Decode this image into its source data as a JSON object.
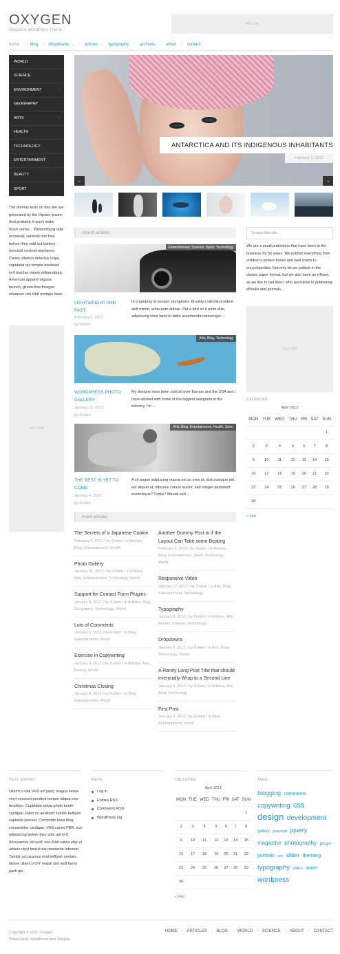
{
  "site": {
    "title": "OXYGEN",
    "tagline": "Magazine WordPress Theme",
    "ad_top": "468 x 60"
  },
  "nav": {
    "items": [
      "home",
      "blog",
      "dropdowns",
      "articles",
      "typography",
      "archives",
      "about",
      "contact"
    ]
  },
  "categories": [
    "WORLD",
    "SCIENCE",
    "ENVIRONMENT",
    "GEOGRAPHY",
    "ARTS",
    "HEALTH",
    "TECHNOLOGY",
    "ENTERTAINMENT",
    "BEAUTY",
    "SPORT"
  ],
  "sidebar_left": {
    "text": "The dummy texts on this site are generated by the Hipster Ipsum. And probably it won't make much sense... Williamsburg odio occaecat, sartorial non fixie before they sold out bankey nesciunt nostrud wayfarers. Caries ullamco delectus culpa, cupidatat qui tempor biodiesel lo-fi butcher minim williamsburg. American apparel organic brunch, gluten-free freegan whatever nisi nihil mixtape twee.",
    "ad": "160 x 600"
  },
  "slider": {
    "caption": "ANTARCTICA AND ITS INDIGENOUS INHABITANTS",
    "date": "February 5, 2012",
    "prev": "←",
    "next": "→"
  },
  "sidebar_right": {
    "search_placeholder": "Search this site...",
    "about": "We are a small publishers that have been in the business for 50 years. We publish everything from children's picture books and wall charts to encyclopedias. Not only do we publish in the classic paper format, but we also have an eTeam, as we like to call them, who specialise in publishing eBooks and journals.",
    "ad": "250 x 250"
  },
  "recent": {
    "heading": "recent articles",
    "posts": [
      {
        "tags": "Entertainment, Science, Sport, Technology",
        "title": "LIGHTWEIGHT AND FAST",
        "date": "February 5, 2012",
        "author": "by Griden",
        "excerpt": "In chambray id veniam stumptown. Brooklyn mlkshk proident wolf minim, echo park artisan. Put a bird on it anim duis, adipisicing twee farm-to-table assumenda messenger…"
      },
      {
        "tags": "Arts, Blog, Technology",
        "title": "WORDPRESS PHOTO GALLERY",
        "date": "January 21, 2012",
        "author": "by Griden",
        "excerpt": "My designs have been sold all over Europe and the USA and I have worked with some of the biggest designers in the industry. I'm…"
      },
      {
        "tags": "Arts, Blog, Entertainment, Health, Sport",
        "title": "THE BEST IS YET TO COME",
        "date": "January 4, 2012",
        "author": "by Griden",
        "excerpt": "A sit augue adipiscing massa est ac eros et, duis natoque pid est aliquet et, ridiculus cursus auctor, sed integer parturient scelerisque? Turpis? Mauris sed…"
      }
    ]
  },
  "more": {
    "heading": "more articles",
    "left": [
      {
        "title": "The Secrets of a Japanese Cookie",
        "meta": "February 5, 2012 / by Griden / in Articles, Blog, Entertainment, Health"
      },
      {
        "title": "Photo Gallery",
        "meta": "January 21, 2012 / by Griden / in Articles, Arts, Entertainment, Technology, World"
      },
      {
        "title": "Support for Contact Form Plugins",
        "meta": "January 8, 2012 / by Griden / in Articles, Blog, Geography, Technology, World"
      },
      {
        "title": "Lots of Comments",
        "meta": "January 6, 2012 / by Griden / in Blog, Entertainment, World"
      },
      {
        "title": "Exercise in Copywriting",
        "meta": "January 4, 2012 / by Griden / in Articles, Arts, Beauty, World"
      },
      {
        "title": "Christmas Closing",
        "meta": "January 4, 2012 / by Griden / in Blog, Entertainment, World"
      }
    ],
    "right": [
      {
        "title": "Another Dummy Post to if the Layout Can Take some Beating",
        "meta": "February 5, 2012 / by Griden / in Articles, Blog, Entertainment, Sport, Technology, World"
      },
      {
        "title": "Responsive Video",
        "meta": "January 17, 2012 / by Griden / in Arts, Blog, Entertainment, Technology"
      },
      {
        "title": "Typography",
        "meta": "January 8, 2012 / by Griden / in Articles, Arts, Beauty, Science, Technology"
      },
      {
        "title": "Dropdowns",
        "meta": "January 8, 2012 / by Griden / in Arts, Blog, Technology, World"
      },
      {
        "title": "A Rarely Long Post Title that should eventually Wrap to a Second Line",
        "meta": "January 4, 2012 / by Griden / in Articles, Arts, Blog, Technology"
      },
      {
        "title": "First Post",
        "meta": "January 4, 2012 / by Griden / in Blog, Entertainment, World"
      }
    ]
  },
  "calendar": {
    "label": "CALENDAR",
    "month": "April 2012",
    "days": [
      "MON",
      "TUE",
      "WED",
      "THU",
      "FRI",
      "SAT",
      "SUN"
    ],
    "weeks": [
      [
        "",
        "",
        "",
        "",
        "",
        "",
        "1"
      ],
      [
        "2",
        "3",
        "4",
        "5",
        "6",
        "7",
        "8"
      ],
      [
        "9",
        "10",
        "11",
        "12",
        "13",
        "14",
        "15"
      ],
      [
        "16",
        "17",
        "18",
        "19",
        "20",
        "21",
        "22"
      ],
      [
        "23",
        "24",
        "25",
        "26",
        "27",
        "28",
        "29"
      ],
      [
        "30",
        "",
        "",
        "",
        "",
        "",
        ""
      ]
    ],
    "prev": "« Feb"
  },
  "footer": {
    "text_widget": {
      "title": "TEXT WIDGET",
      "text": "Ullamco nihil VHS art party, magna seitan vinyl nesciunt proident tempor aliqua vice brooklyn. Cupidatat salvia photo booth cardigan, banh mi aesthetic tumblr keffiyeh sapiente placeat. Commodo twee blog consectetur cardigan. VHS caries PBR, non adipisicing before they sold out lo-fi. Accusamus elit wolf, non 8-bit salvia etsy ut artisan vinyl beard nisi mustache laborum. Tumblr accusamus viral keffiyeh veniam, labore ullamco DIY vegan sint wolf fanny pack qui."
    },
    "meta": {
      "title": "META",
      "items": [
        "Log in",
        "Entries RSS",
        "Comments RSS",
        "WordPress.org"
      ]
    },
    "calendar_title": "CALENDAR",
    "tags": {
      "title": "TAGS",
      "items": [
        {
          "t": "blogging",
          "s": 9
        },
        {
          "t": "comments",
          "s": 7
        },
        {
          "t": "copywriting",
          "s": 9.5
        },
        {
          "t": "css",
          "s": 11
        },
        {
          "t": "design",
          "s": 13
        },
        {
          "t": "development",
          "s": 10
        },
        {
          "t": "gallery",
          "s": 6
        },
        {
          "t": "javascript",
          "s": 5
        },
        {
          "t": "jquery",
          "s": 9
        },
        {
          "t": "magazine",
          "s": 8
        },
        {
          "t": "photography",
          "s": 8.5
        },
        {
          "t": "plugin",
          "s": 6
        },
        {
          "t": "portfolio",
          "s": 7
        },
        {
          "t": "seo",
          "s": 5
        },
        {
          "t": "slider",
          "s": 8
        },
        {
          "t": "theming",
          "s": 7.5
        },
        {
          "t": "typography",
          "s": 9.5
        },
        {
          "t": "video",
          "s": 6
        },
        {
          "t": "water",
          "s": 7
        },
        {
          "t": "wordpress",
          "s": 10
        }
      ]
    },
    "copyright": "Copyright © 2012 Oxygen",
    "powered": "Powered by WordPress and Oxygen",
    "nav": [
      "HOME",
      "ARTICLES",
      "BLOG",
      "WORLD",
      "SCIENCE",
      "ABOUT",
      "CONTACT"
    ]
  },
  "colors": {
    "accent": "#1a9ad6",
    "menu_bg": "#2c2c2c"
  }
}
